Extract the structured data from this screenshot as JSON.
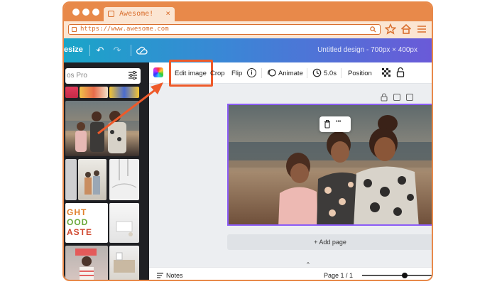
{
  "browser": {
    "tab_title": "Awesome!",
    "tab_close": "×",
    "url": "https://www.awesome.com",
    "icons": [
      "star-icon",
      "home-icon",
      "menu-icon",
      "search-icon"
    ]
  },
  "appbar": {
    "resize_label": "esize",
    "doc_title": "Untitled design - 700px × 400px",
    "undo_glyph": "↶",
    "redo_glyph": "↷"
  },
  "sidebar": {
    "search_placeholder": "os Pro",
    "thumb_text_1": "GHT",
    "thumb_text_2": "OOD",
    "thumb_text_3": "ASTE"
  },
  "editbar": {
    "edit_image": "Edit image",
    "crop": "Crop",
    "flip": "Flip",
    "info_glyph": "i",
    "animate": "Animate",
    "duration": "5.0s",
    "position": "Position"
  },
  "canvas": {
    "popup_trash": "🗑",
    "popup_more": "•••",
    "add_page": "+ Add page",
    "collapse_glyph": "^"
  },
  "footer": {
    "notes": "Notes",
    "page_indicator": "Page 1 / 1"
  },
  "colors": {
    "browser_frame": "#e8894a",
    "highlight": "#ee5a2a",
    "selection": "#8b5cf6"
  }
}
